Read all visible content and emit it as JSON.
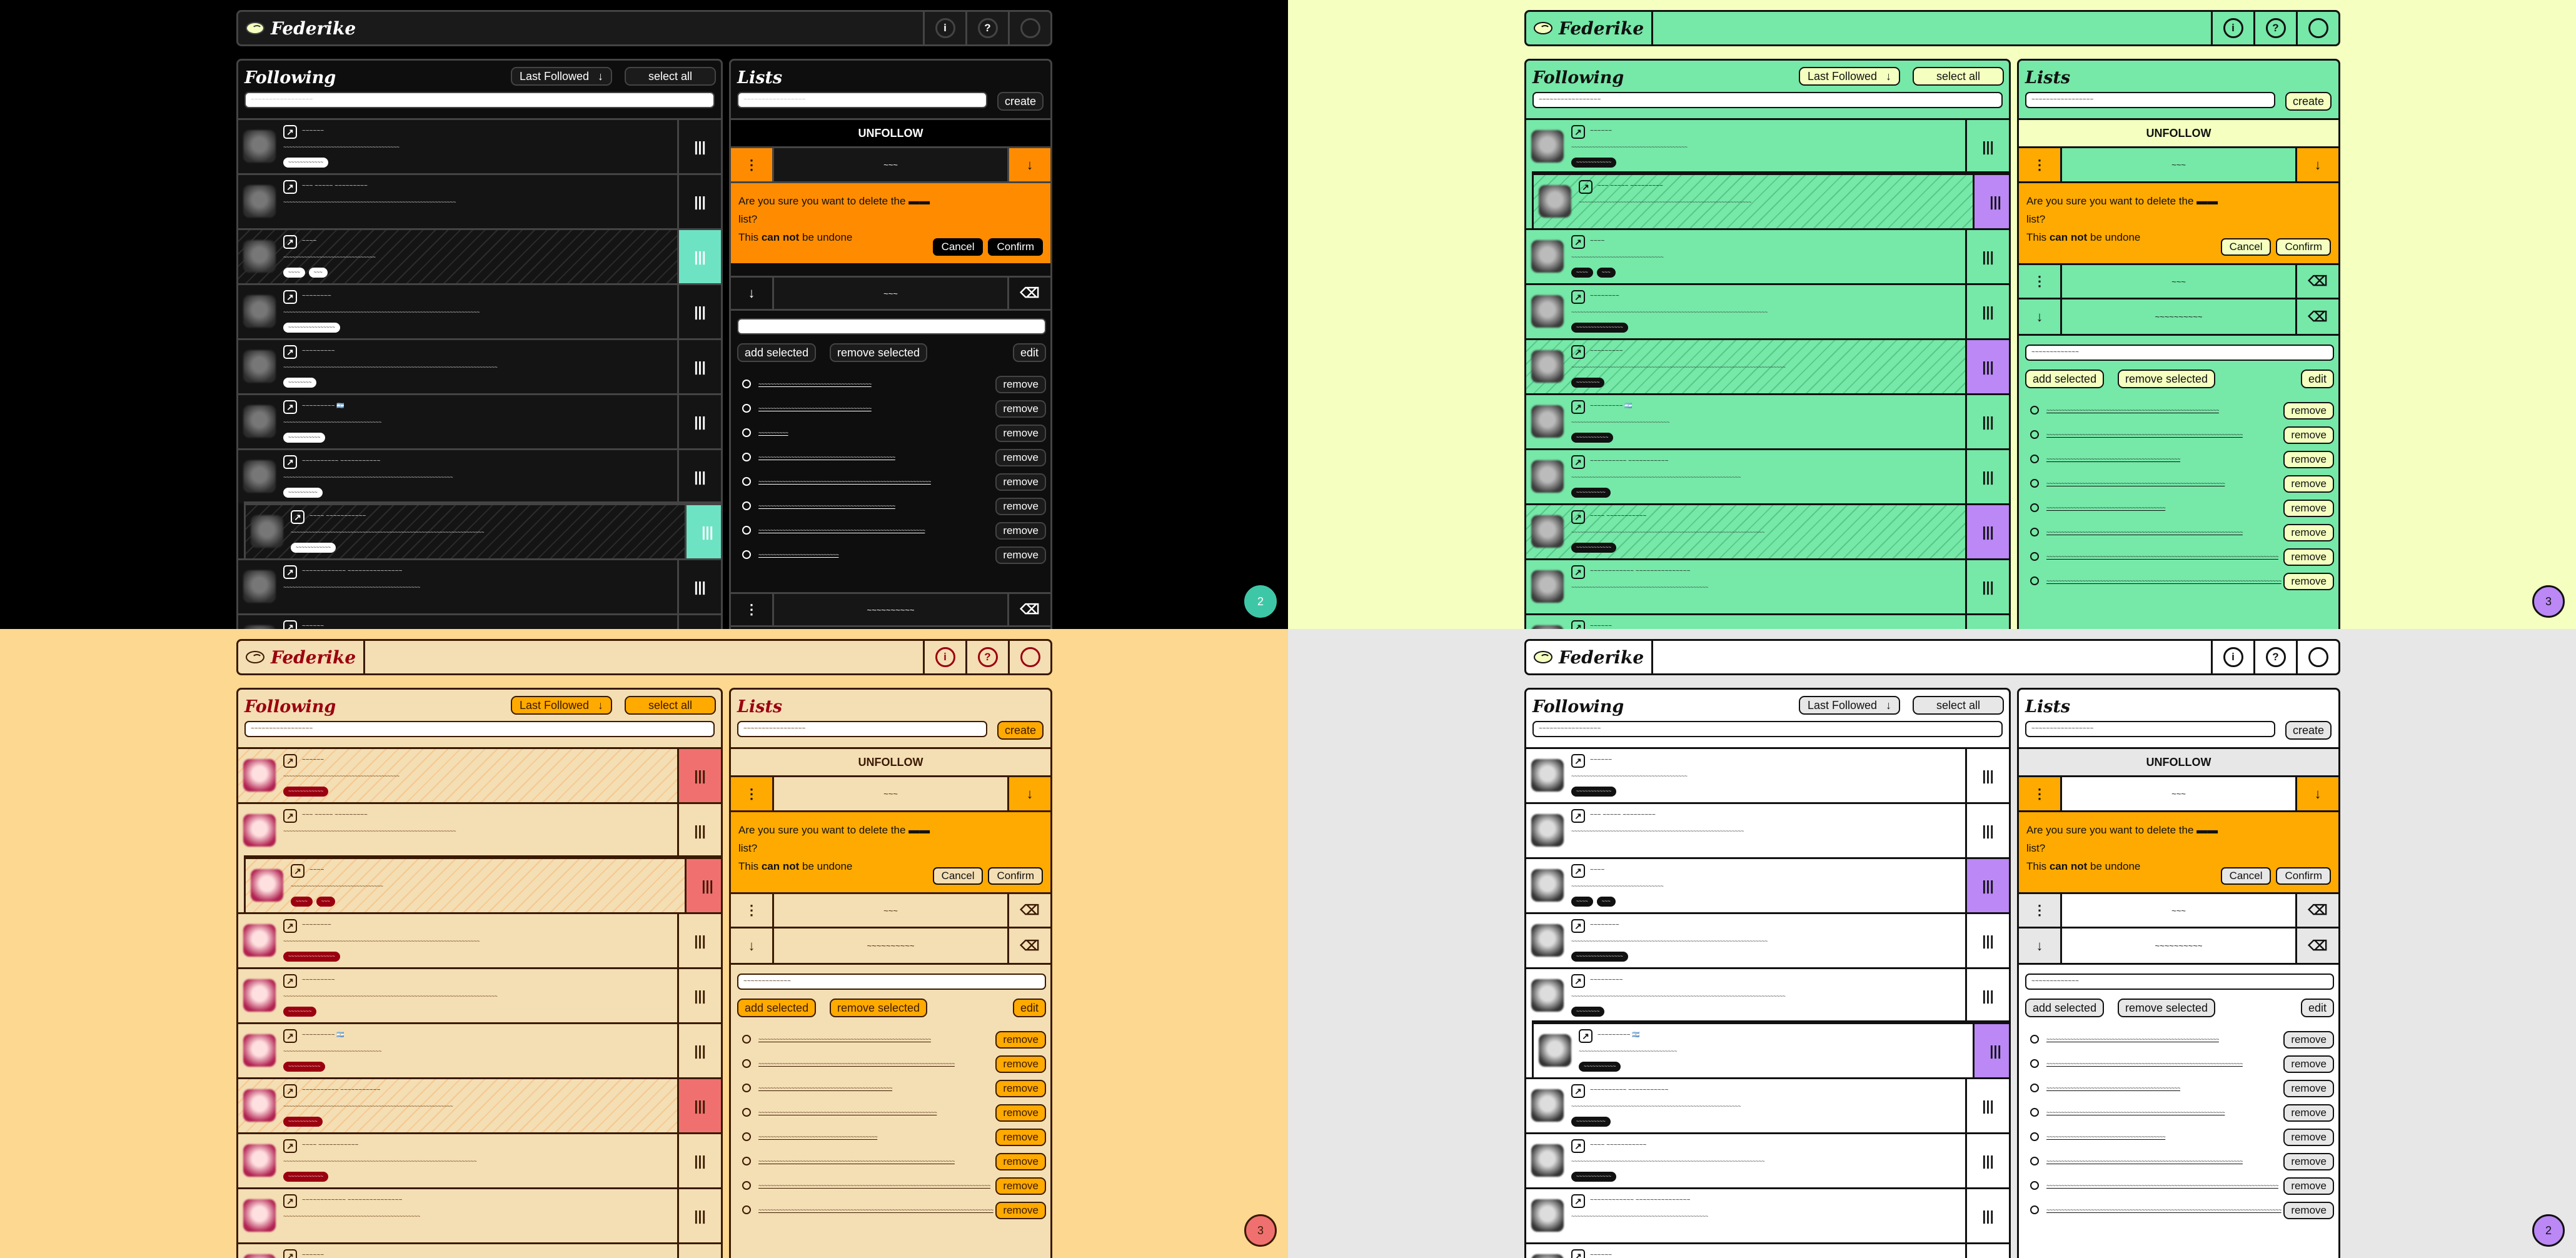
{
  "app": {
    "title": "Federike"
  },
  "header": {
    "info_icon": "info-icon",
    "help_icon": "help-icon",
    "account_icon": "account-circle-icon"
  },
  "following": {
    "title": "Following",
    "sort_label": "Last Followed",
    "select_all_label": "select all",
    "search_placeholder": "~~~~~~~~~~~~~~~~~",
    "handle_glyph": "|||",
    "link_glyph": "↗",
    "users": [
      {
        "name": "~~~~~~",
        "desc": "~~~~~~~~~~~~~~~~~~~~~~~~~~~~~~~~~~~~~~~",
        "badges": [
          "~~~~~~~~~~~~"
        ]
      },
      {
        "name": "~~~ ~~~~~ ~~~~~~~~~",
        "desc": "~~~~~~~~~~~~~~~~~~~~~~~~~~~~~~~~~~~~~~~~~~~~~~~~~~~~~~~~~~",
        "badges": []
      },
      {
        "name": "~~~~",
        "desc": "~~~~~~~~~~~~~~~~~~~~~~~~~~~~~~~",
        "badges": [
          "~~~~",
          "~~~"
        ]
      },
      {
        "name": "~~~~~~~~",
        "desc": "~~~~~~~~~~~~~~~~~~~~~~~~~~~~~~~~~~~~~~~~~~~~~~~~~~~~~~~~~~~~~~~~~~",
        "badges": [
          "~~~~~~~~~~~~~~~~"
        ]
      },
      {
        "name": "~~~~~~~~~",
        "desc": "~~~~~~~~~~~~~~~~~~~~~~~~~~~~~~~~~~~~~~~~~~~~~~~~~~~~~~~~~~~~~~~~~~~~~~~~",
        "badges": [
          "~~~~~~~~"
        ]
      },
      {
        "name": "~~~~~~~~~ 🇦🇷",
        "desc": "~~~~~~~~~~~~~~~~~~~~~~~~~~~~~~~~~",
        "badges": [
          "~~~~~~~~~~~"
        ]
      },
      {
        "name": "~~~~~~~~~~ ~~~~~~~~~~~",
        "desc": "~~~~~~~~~~~~~~~~~~~~~~~~~~~~~~~~~~~~~~~~~~~~~~~~~~~~~~~~~",
        "badges": [
          "~~~~~~~~~~"
        ]
      },
      {
        "name": "~~~~ ~~~~~~~~~~~",
        "desc": "~~~~~~~~~~~~~~~~~~~~~~~~~~~~~~~~~~~~~~~~~~~~~~~~~~~~~~~~~~~~~~~~~",
        "badges": [
          "~~~~~~~~~~~~"
        ]
      },
      {
        "name": "~~~~~~~~~~~~ ~~~~~~~~~~~~~~~",
        "desc": "~~~~~~~~~~~~~~~~~~~~~~~~~~~~~~~~~~~~~~~~~~~~~~",
        "badges": []
      },
      {
        "name": "~~~~~~",
        "desc": "",
        "badges": []
      }
    ]
  },
  "lists": {
    "title": "Lists",
    "search_placeholder": "~~~~~~~~~~~~~~~~~",
    "create_label": "create",
    "unfollow_label": "UNFOLLOW",
    "list_a_name": "~~~",
    "list_b_name": "~~~",
    "list_c_name": "~~~~~~~~~~",
    "list_search_value": "~~~~~~~~~~~~~",
    "confirm": {
      "prefix": "Are you sure you want to delete the",
      "list_ref": " ▬▬ ",
      "suffix": "list?",
      "line2_pre": "This ",
      "line2_bold": "can not",
      "line2_post": " be undone",
      "cancel": "Cancel",
      "confirm": "Confirm"
    },
    "add_selected_label": "add selected",
    "remove_selected_label": "remove selected",
    "edit_label": "edit",
    "remove_label": "remove",
    "members_dark": [
      "~~~~~~~~~~~~~~~~~~~~~~~~~~~~~~~~~~~~~~",
      "~~~~~~~~~~~~~~~~~~~~~~~~~~~~~~~~~~~~~~",
      "~~~~~~~~~~",
      "~~~~~~~~~~~~~~~~~~~~~~~~~~~~~~~~~~~~~~~~~~~~~~",
      "~~~~~~~~~~~~~~~~~~~~~~~~~~~~~~~~~~~~~~~~~~~~~~~~~~~~~~~~~~",
      "~~~~~~~~~~~~~~~~~~~~~~~~~~~~~~~~~~~~~~~~~~~~~~",
      "~~~~~~~~~~~~~~~~~~~~~~~~~~~~~~~~~~~~~~~~~~~~~~~~~~~~~~~~",
      "~~~~~~~~~~~~~~~~~~~~~~~~~~~"
    ],
    "members": [
      "~~~~~~~~~~~~~~~~~~~~~~~~~~~~~~~~~~~~~~~~~~~~~~~~~~~~~~~~~~",
      "~~~~~~~~~~~~~~~~~~~~~~~~~~~~~~~~~~~~~~~~~~~~~~~~~~~~~~~~~~~~~~~~~~",
      "~~~~~~~~~~~~~~~~~~~~~~~~~~~~~~~~~~~~~~~~~~~~~",
      "~~~~~~~~~~~~~~~~~~~~~~~~~~~~~~~~~~~~~~~~~~~~~~~~~~~~~~~~~~~~",
      "~~~~~~~~~~~~~~~~~~~~~~~~~~~~~~~~~~~~~~~~",
      "~~~~~~~~~~~~~~~~~~~~~~~~~~~~~~~~~~~~~~~~~~~~~~~~~~~~~~~~~~~~~~~~~~",
      "~~~~~~~~~~~~~~~~~~~~~~~~~~~~~~~~~~~~~~~~~~~~~~~~~~~~~~~~~~~~~~~~~~~~~~~~~~~~~~",
      "~~~~~~~~~~~~~~~~~~~~~~~~~~~~~~~~~~~~~~~~~~~~~~~~~~~~~~~~~~~~~~~~~~~~~~~~~~~~~~~"
    ]
  },
  "pagers": {
    "dark": "2",
    "mint": "3",
    "orange": "3",
    "grey": "2"
  },
  "colors": {
    "dark_bg": "#000000",
    "mint_bg": "#f5ffc0",
    "orange_bg": "#fcd890",
    "grey_bg": "#e7e7e7",
    "mint_accent": "#76e8a8",
    "purple_highlight": "#bb88f6",
    "orange_warn": "#ff8c00",
    "amber_warn": "#ffaa00",
    "salmon_handle": "#f07070",
    "teal_handle": "#6ee3c4",
    "burgundy": "#9a0010"
  }
}
